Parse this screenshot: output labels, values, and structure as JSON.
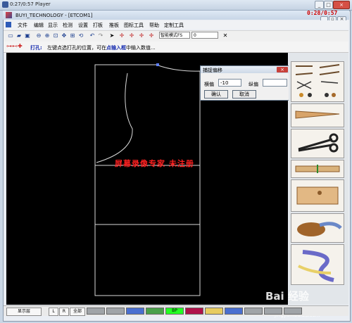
{
  "player": {
    "title": "0:27/0:57 Player",
    "controls": [
      "_",
      "□",
      "×"
    ]
  },
  "app": {
    "title": "BUYI_TECHNOLOGY - [ETCOM1]",
    "timer": "0:28/0:57"
  },
  "menu": {
    "items": [
      "文件",
      "编辑",
      "显示",
      "检测",
      "设置",
      "打板",
      "推板",
      "图标工具",
      "帮助",
      "定制工具"
    ]
  },
  "toolbar": {
    "mode_label": "智能模式FS",
    "mode_value": "0"
  },
  "hint": {
    "tool_name": "打孔:",
    "text_before": "左键点选打孔的位置，可在",
    "text_highlight": "点输入框",
    "text_after": "中输入数值..."
  },
  "dialog": {
    "title": "捕捉偏移",
    "horizontal_label": "横偏",
    "horizontal_value": "-10",
    "vertical_label": "纵偏",
    "vertical_value": "",
    "ok_label": "确认",
    "cancel_label": "取消",
    "close_label": "×"
  },
  "watermark": {
    "text": "屏幕录像专家  未注册"
  },
  "statusbar": {
    "layer_label": "显示层",
    "btn_l": "L",
    "btn_r": "R",
    "btn_all": "全部",
    "swatches": [
      {
        "color": "#a0a4a8",
        "label": ""
      },
      {
        "color": "#a0a4a8",
        "label": ""
      },
      {
        "color": "#4a6fd0",
        "label": ""
      },
      {
        "color": "#4aa04a",
        "label": ""
      },
      {
        "color": "#22ff22",
        "label": "BP"
      },
      {
        "color": "#b0124a",
        "label": ""
      },
      {
        "color": "#e8cc60",
        "label": ""
      },
      {
        "color": "#4a6fd0",
        "label": ""
      },
      {
        "color": "#a0a4a8",
        "label": ""
      },
      {
        "color": "#a0a4a8",
        "label": ""
      },
      {
        "color": "#a0a4a8",
        "label": ""
      }
    ]
  },
  "baidu": {
    "logo_text": "Bai 经验",
    "url": "jingyan.baidu.com"
  }
}
